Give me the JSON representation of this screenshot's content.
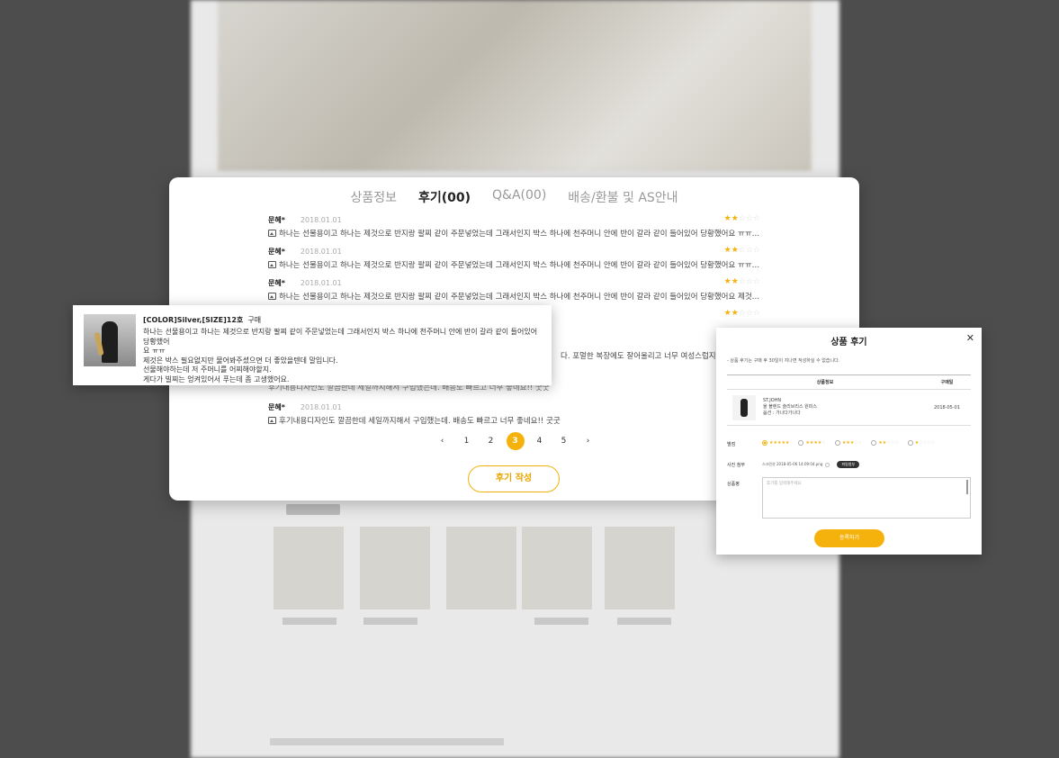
{
  "tabs": [
    {
      "label": "상품정보"
    },
    {
      "label": "후기(00)"
    },
    {
      "label": "Q&A(00)"
    },
    {
      "label": "배송/환불 및 AS안내"
    }
  ],
  "reviews": [
    {
      "name": "문혜*",
      "date": "2018.01.01",
      "stars": "★★☆☆☆",
      "text": "하나는 선물용이고 하나는 제것으로 반지랑 팔찌 같이 주문넣었는데 그래서인지 박스 하나에 천주머니 안에 반이 갈라 같이 들어있어 당황했어요 ㅠㅠ 제것..."
    },
    {
      "name": "문혜*",
      "date": "2018.01.01",
      "stars": "★★☆☆☆",
      "text": "하나는 선물용이고 하나는 제것으로 반지랑 팔찌 같이 주문넣었는데 그래서인지 박스 하나에 천주머니 안에 반이 갈라 같이 들어있어 당황했어요 ㅠㅠ 제것..."
    },
    {
      "name": "문혜*",
      "date": "2018.01.01",
      "stars": "★★☆☆☆",
      "text": "하나는 선물용이고 하나는 제것으로 반지랑 팔찌 같이 주문넣었는데 그래서인지 박스 하나에 천주머니 안에 반이 갈라 같이 들어있어 당황했어요 제것은ㅠㅠ..."
    },
    {
      "name": "",
      "date": "",
      "stars": "★★☆☆☆",
      "text": ""
    }
  ],
  "partial_review": {
    "text": "다. 포멀한 복장에도 잘어울리고 너무 여성스럽지는 않지만"
  },
  "hidden_review": {
    "text": "후기내용디자인도 깔끔한데 세일까지해서 구입했는데. 배송도 빠르고 너무 좋네요!! 굿굿"
  },
  "last_review": {
    "name": "문혜*",
    "date": "2018.01.01",
    "text": "후기내용디자인도 깔끔한데 세일까지해서 구입했는데. 배송도 빠르고 너무 좋네요!! 굿굿"
  },
  "pagination": {
    "prev": "‹",
    "pages": [
      "1",
      "2",
      "3",
      "4",
      "5"
    ],
    "current": "3",
    "next": "›"
  },
  "write_button": "후기 작성",
  "popover": {
    "option": "[COLOR]Silver,[SIZE]12호",
    "purchase": "구매",
    "lines": [
      "하나는 선물용이고 하나는 제것으로 반지랑 팔찌 같이 주문넣었는데 그래서인지 박스 하나에 천주머니 안에 반이 갈라 같이 들어있어 당황했어",
      "요 ㅠㅠ",
      "제것은 박스 필요없지만 물어봐주셨으면 더 좋았을텐데 말입니다.",
      "선물해야하는데 저 주머니를 어찌해야할지.",
      "게다가 빌찌는 엉켜있어서 푸는데 좀 고생했어요."
    ]
  },
  "modal": {
    "title": "상품 후기",
    "close": "✕",
    "note": "- 상품 후기는 구매 후 30일이 지나면 작성하실 수 없습니다.",
    "col_product": "상품정보",
    "col_date": "구매일",
    "product_brand": "ST.JOHN",
    "product_name": "울 블렌드 슬리브리스 원피스",
    "product_option": "옵션 : 가나다가나다",
    "purchase_date": "2018-05-01",
    "rating_label": "별점",
    "ratings": [
      "★★★★★",
      "★★★★☆",
      "★★★☆☆",
      "★★☆☆☆",
      "★☆☆☆☆"
    ],
    "photo_label": "사진 첨부",
    "file_name": "스크린샷 2018-05-06 14:09:04.png",
    "file_button": "파일첨부",
    "review_label": "상품평",
    "textarea_placeholder": "후기를 입력해주세요",
    "submit": "등록하기"
  },
  "colors": {
    "accent": "#f5b20c",
    "backdrop": "#4d4d4d"
  }
}
